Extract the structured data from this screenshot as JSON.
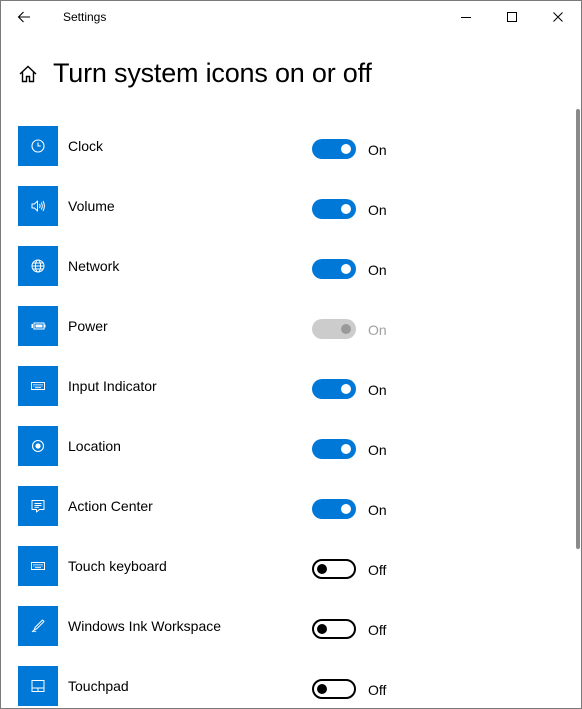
{
  "window": {
    "title": "Settings"
  },
  "page": {
    "title": "Turn system icons on or off"
  },
  "items": [
    {
      "label": "Clock",
      "state": "On",
      "toggle": "on",
      "icon": "clock-icon"
    },
    {
      "label": "Volume",
      "state": "On",
      "toggle": "on",
      "icon": "volume-icon"
    },
    {
      "label": "Network",
      "state": "On",
      "toggle": "on",
      "icon": "globe-icon"
    },
    {
      "label": "Power",
      "state": "On",
      "toggle": "disabled",
      "icon": "battery-icon"
    },
    {
      "label": "Input Indicator",
      "state": "On",
      "toggle": "on",
      "icon": "keyboard-icon"
    },
    {
      "label": "Location",
      "state": "On",
      "toggle": "on",
      "icon": "location-icon"
    },
    {
      "label": "Action Center",
      "state": "On",
      "toggle": "on",
      "icon": "action-center-icon"
    },
    {
      "label": "Touch keyboard",
      "state": "Off",
      "toggle": "off",
      "icon": "keyboard-icon"
    },
    {
      "label": "Windows Ink Workspace",
      "state": "Off",
      "toggle": "off",
      "icon": "pen-icon"
    },
    {
      "label": "Touchpad",
      "state": "Off",
      "toggle": "off",
      "icon": "touchpad-icon"
    }
  ],
  "colors": {
    "accent": "#0078d7",
    "disabled": "#cccccc"
  }
}
